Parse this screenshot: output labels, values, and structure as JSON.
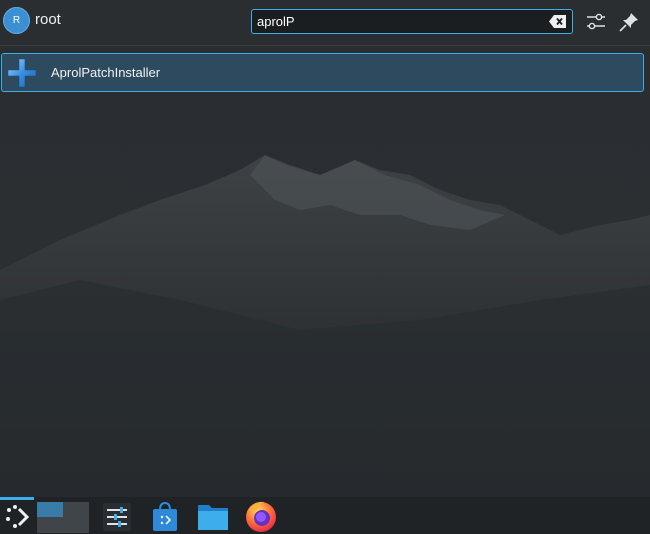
{
  "user": {
    "avatar_letter": "R",
    "name": "root"
  },
  "search": {
    "value": "aprolP",
    "placeholder": ""
  },
  "results": [
    {
      "label": "AprolPatchInstaller",
      "icon": "blue-plus-icon"
    }
  ],
  "header_buttons": [
    "configure-icon",
    "pin-icon"
  ],
  "taskbar": [
    "app-launcher-icon",
    "pager-widget",
    "system-settings-icon",
    "discover-store-icon",
    "file-manager-icon",
    "firefox-icon"
  ],
  "colors": {
    "accent": "#3daee9",
    "selection": "#2e4a5e",
    "background": "#262a2d"
  }
}
